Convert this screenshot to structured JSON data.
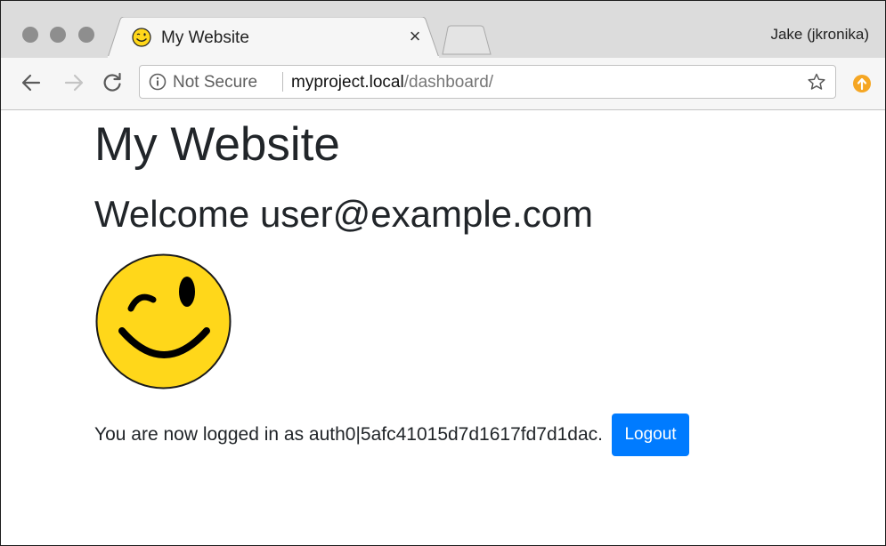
{
  "browser": {
    "tab": {
      "title": "My Website",
      "close_glyph": "×",
      "favicon": "smiley-icon"
    },
    "profile_name": "Jake (jkronika)",
    "address_bar": {
      "security_label": "Not Secure",
      "url_host": "myproject.local",
      "url_path": "/dashboard/"
    },
    "icons": {
      "back": "arrow-left-icon",
      "forward": "arrow-right-icon",
      "reload": "reload-icon",
      "info": "info-icon",
      "bookmark": "star-icon",
      "extension": "update-arrow-icon"
    },
    "colors": {
      "extension_accent": "#f5a623",
      "button_primary": "#007bff",
      "smiley_fill": "#ffd71a"
    }
  },
  "page": {
    "site_title": "My Website",
    "welcome_text": "Welcome user@example.com",
    "status_text": "You are now logged in as auth0|5afc41015d7d1617fd7d1dac.",
    "logout_label": "Logout"
  }
}
